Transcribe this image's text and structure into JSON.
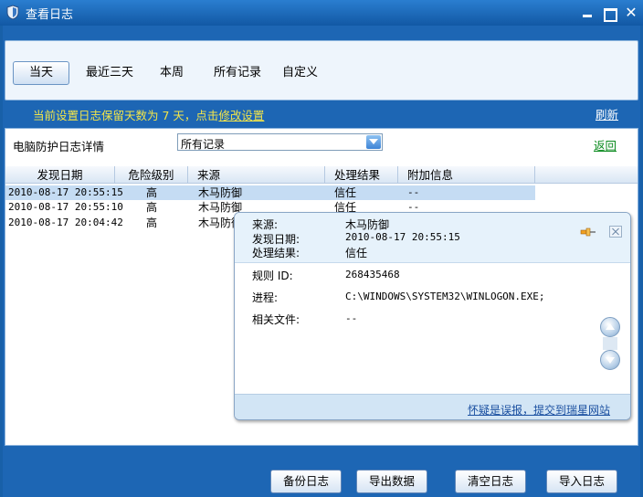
{
  "window": {
    "title": "查看日志"
  },
  "tabs": [
    {
      "label": "当天",
      "active": true
    },
    {
      "label": "最近三天",
      "active": false
    },
    {
      "label": "本周",
      "active": false
    },
    {
      "label": "所有记录",
      "active": false
    },
    {
      "label": "自定义",
      "active": false
    }
  ],
  "retention": {
    "prefix": "当前设置日志保留天数为 7 天，点击",
    "link": "修改设置"
  },
  "refresh_label": "刷新",
  "log": {
    "title": "电脑防护日志详情",
    "filter_value": "所有记录",
    "back_label": "返回"
  },
  "table": {
    "columns": [
      "发现日期",
      "危险级别",
      "来源",
      "处理结果",
      "附加信息"
    ],
    "rows": [
      {
        "date": "2010-08-17 20:55:15",
        "level": "高",
        "source": "木马防御",
        "result": "信任",
        "info": "--",
        "selected": true
      },
      {
        "date": "2010-08-17 20:55:10",
        "level": "高",
        "source": "木马防御",
        "result": "信任",
        "info": "--",
        "selected": false
      },
      {
        "date": "2010-08-17 20:04:42",
        "level": "高",
        "source": "木马防御",
        "result": "",
        "info": "",
        "selected": false
      }
    ]
  },
  "detail": {
    "source_label": "来源:",
    "source_value": "木马防御",
    "date_label": "发现日期:",
    "date_value": "2010-08-17 20:55:15",
    "result_label": "处理结果:",
    "result_value": "信任",
    "rule_label": "规则 ID:",
    "rule_value": "268435468",
    "process_label": "进程:",
    "process_value": "C:\\WINDOWS\\SYSTEM32\\WINLOGON.EXE;",
    "file_label": "相关文件:",
    "file_value": "--",
    "report_link": "怀疑是误报，提交到瑞星网站"
  },
  "buttons": {
    "backup": "备份日志",
    "export": "导出数据",
    "clear": "清空日志",
    "import": "导入日志"
  },
  "colors": {
    "window_bg": "#1860a8",
    "accent_yellow": "#f3e54a",
    "link_green": "#0a8a1e",
    "selected_row": "#c5dcf3"
  }
}
